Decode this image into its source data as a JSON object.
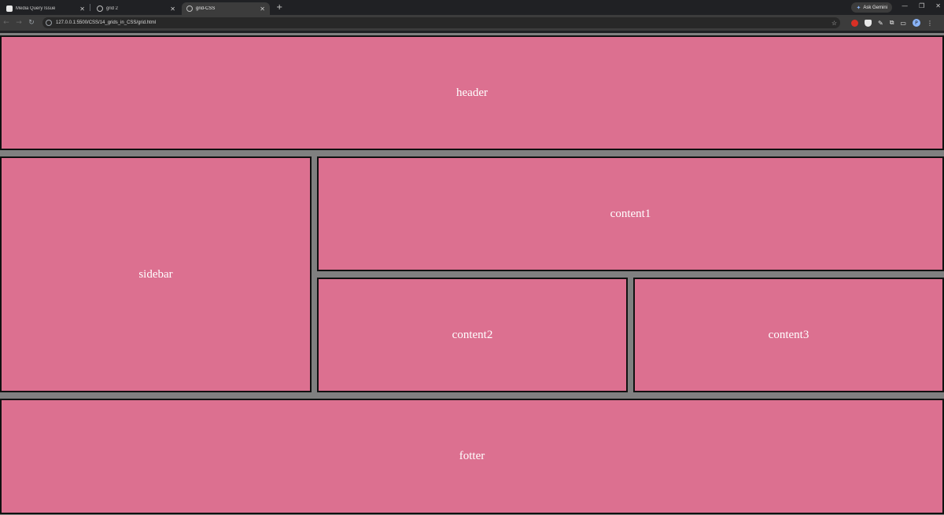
{
  "browser": {
    "tabs": [
      {
        "title": "Media Query Issue",
        "active": false,
        "icon": "document-icon"
      },
      {
        "title": "grid 2",
        "active": false,
        "icon": "globe-icon"
      },
      {
        "title": "grid-CSS",
        "active": true,
        "icon": "globe-icon"
      }
    ],
    "gemini_label": "Ask Gemini",
    "url": "127.0.0.1:5500/CSS/14_grids_in_CSS/grid.html",
    "profile_initial": "P"
  },
  "page": {
    "header": "header",
    "sidebar": "sidebar",
    "content1": "content1",
    "content2": "content2",
    "content3": "content3",
    "footer": "fotter"
  },
  "colors": {
    "cell_background": "#dc7090",
    "page_background": "#808080",
    "cell_border": "#111111",
    "cell_text": "#ffffff"
  }
}
